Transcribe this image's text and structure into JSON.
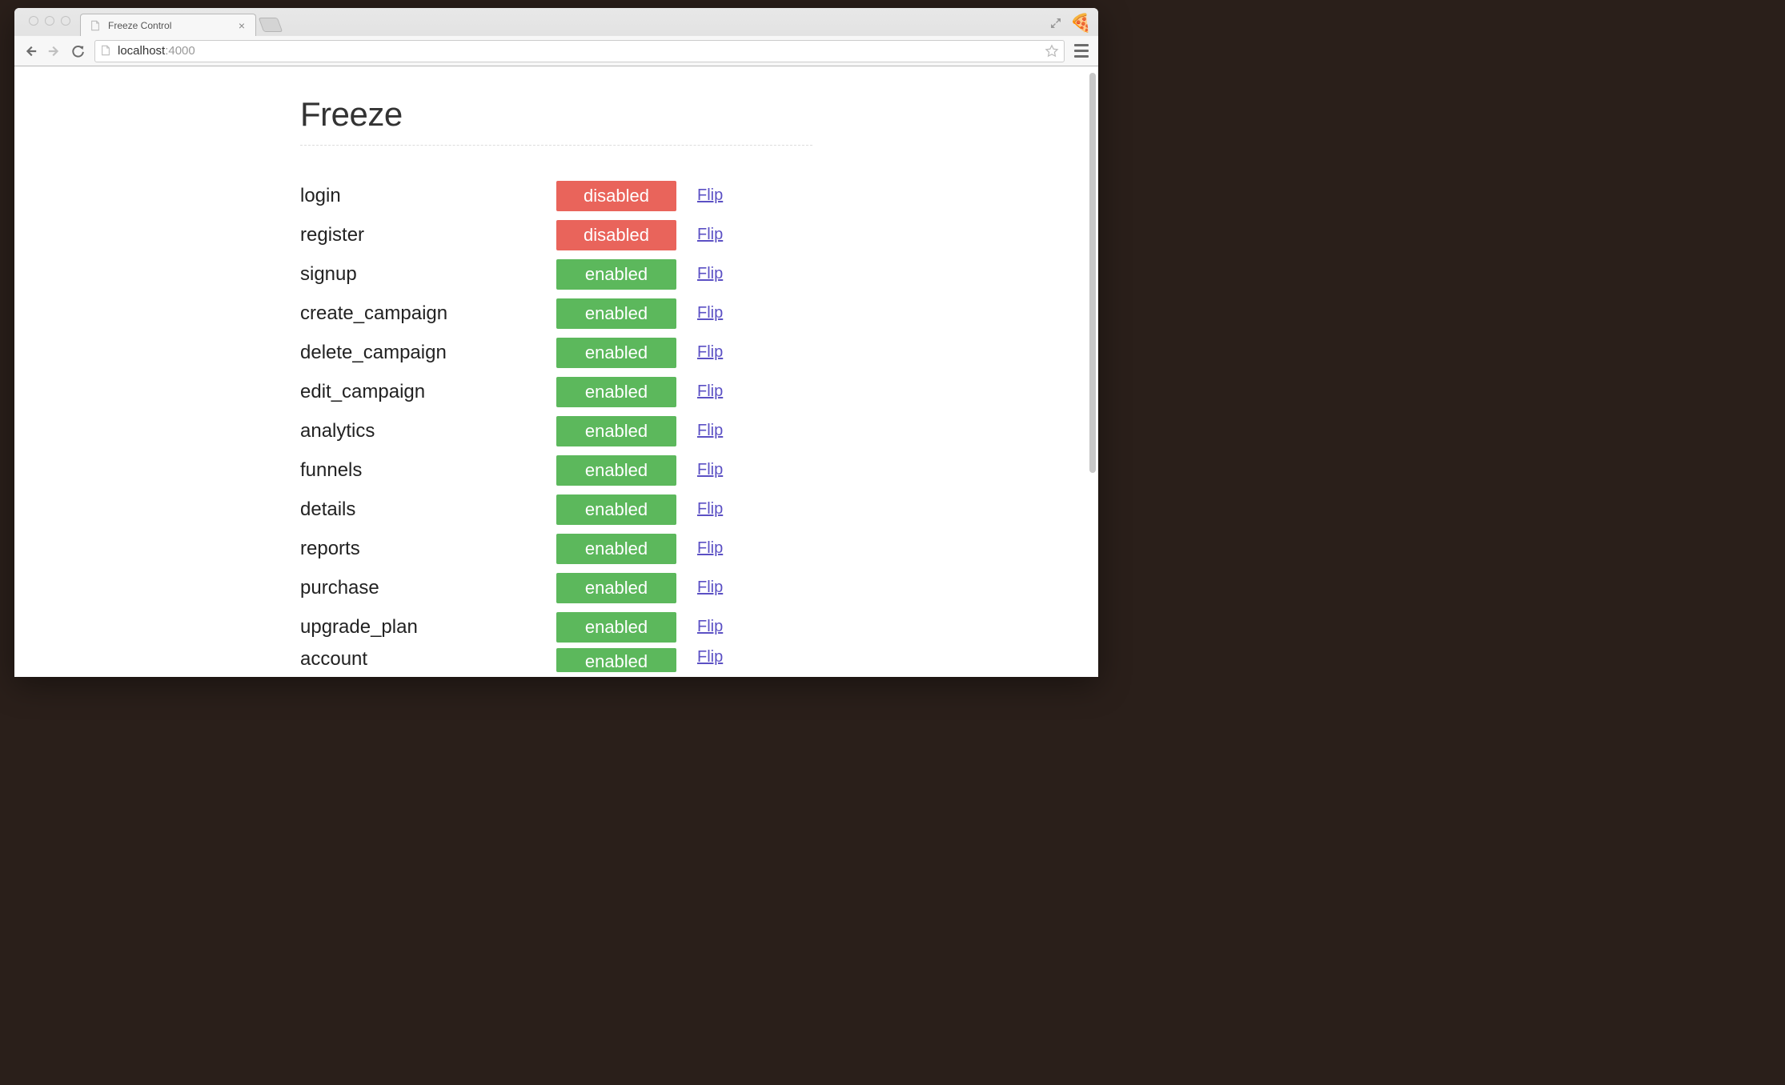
{
  "browser": {
    "tab_title": "Freeze Control",
    "url_host": "localhost",
    "url_port": ":4000"
  },
  "page": {
    "title": "Freeze"
  },
  "status_labels": {
    "enabled": "enabled",
    "disabled": "disabled"
  },
  "flip_label": "Flip",
  "features": [
    {
      "name": "login",
      "status": "disabled"
    },
    {
      "name": "register",
      "status": "disabled"
    },
    {
      "name": "signup",
      "status": "enabled"
    },
    {
      "name": "create_campaign",
      "status": "enabled"
    },
    {
      "name": "delete_campaign",
      "status": "enabled"
    },
    {
      "name": "edit_campaign",
      "status": "enabled"
    },
    {
      "name": "analytics",
      "status": "enabled"
    },
    {
      "name": "funnels",
      "status": "enabled"
    },
    {
      "name": "details",
      "status": "enabled"
    },
    {
      "name": "reports",
      "status": "enabled"
    },
    {
      "name": "purchase",
      "status": "enabled"
    },
    {
      "name": "upgrade_plan",
      "status": "enabled"
    },
    {
      "name": "account",
      "status": "enabled"
    }
  ],
  "colors": {
    "enabled": "#5cb85c",
    "disabled": "#e9645b",
    "link": "#5b50c4"
  }
}
